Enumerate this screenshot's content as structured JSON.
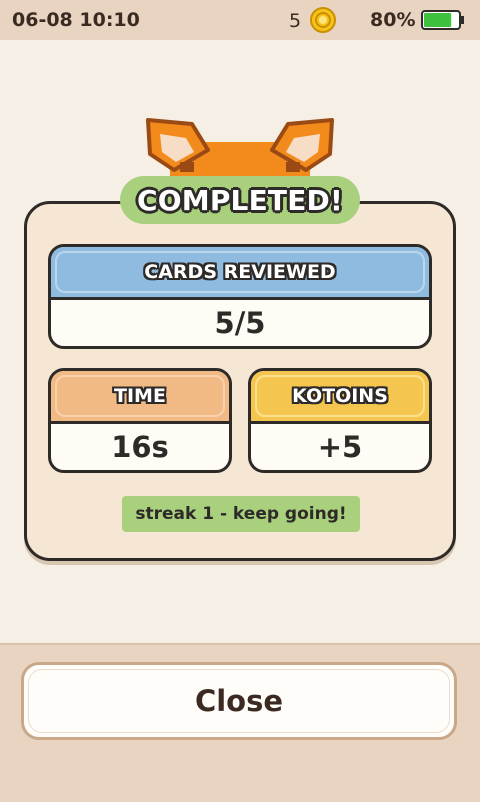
{
  "status_bar": {
    "time": "06-08 10:10",
    "coins": "5",
    "coin_icon": "coin-icon",
    "battery": "80%",
    "battery_level": 0.8,
    "battery_color": "#3ec23e"
  },
  "dialog": {
    "title": "COMPLETED!",
    "cards_reviewed_label": "CARDS REVIEWED",
    "cards_reviewed_value": "5/5",
    "time_label": "TIME",
    "time_value": "16s",
    "kotoins_label": "KOTOINS",
    "kotoins_value": "+5",
    "streak_text": "streak 1 - keep going!"
  },
  "footer": {
    "close_label": "Close"
  },
  "colors": {
    "banner": "#a8d07d",
    "cards_header": "#8fbbe0",
    "time_header": "#f1b983",
    "kotoins_header": "#f5c64f",
    "background": "#f5efe6"
  }
}
